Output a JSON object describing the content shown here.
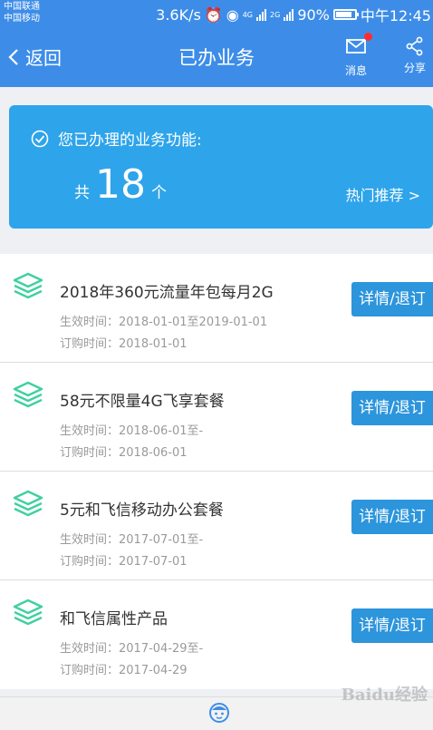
{
  "status_bar": {
    "carrier_1": "中国联通",
    "carrier_2": "中国移动",
    "speed": "3.6K/s",
    "net_1": "4G",
    "net_2": "2G",
    "battery": "90%",
    "time": "中午12:45"
  },
  "navbar": {
    "back_label": "返回",
    "title": "已办业务",
    "message_label": "消息",
    "share_label": "分享"
  },
  "summary": {
    "heading": "您已办理的业务功能:",
    "prefix": "共",
    "count": "18",
    "suffix": "个",
    "hot_link": "热门推荐 >"
  },
  "items": [
    {
      "name": "2018年360元流量年包每月2G",
      "effective": "生效时间：2018-01-01至2019-01-01",
      "ordered": "订购时间：2018-01-01",
      "button": "详情/退订"
    },
    {
      "name": "58元不限量4G飞享套餐",
      "effective": "生效时间：2018-06-01至-",
      "ordered": "订购时间：2018-06-01",
      "button": "详情/退订"
    },
    {
      "name": "5元和飞信移动办公套餐",
      "effective": "生效时间：2017-07-01至-",
      "ordered": "订购时间：2017-07-01",
      "button": "详情/退订"
    },
    {
      "name": "和飞信属性产品",
      "effective": "生效时间：2017-04-29至-",
      "ordered": "订购时间：2017-04-29",
      "button": "详情/退订"
    }
  ],
  "watermark": "Baidu经验",
  "colors": {
    "primary": "#3d8de8",
    "card": "#2ea4ea",
    "button": "#2c95dc",
    "icon": "#3fd0a0",
    "badge": "#ff2d2d"
  }
}
